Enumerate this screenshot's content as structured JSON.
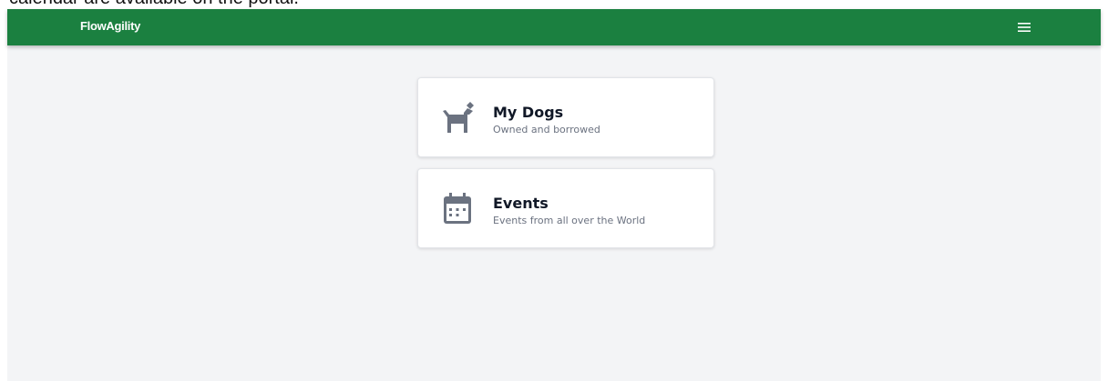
{
  "caption": {
    "text": "calendar are available on the portal."
  },
  "header": {
    "brand": "FlowAgility",
    "menu_icon": "hamburger-menu-icon",
    "background_color": "#1b8040"
  },
  "cards": [
    {
      "title": "My Dogs",
      "subtitle": "Owned and borrowed",
      "icon": "dog-icon"
    },
    {
      "title": "Events",
      "subtitle": "Events from all over the World",
      "icon": "calendar-icon"
    }
  ],
  "colors": {
    "page_background": "#f3f4f6",
    "card_background": "#ffffff",
    "icon_color": "#6b7280",
    "title_color": "#111827",
    "subtitle_color": "#6b7280"
  }
}
